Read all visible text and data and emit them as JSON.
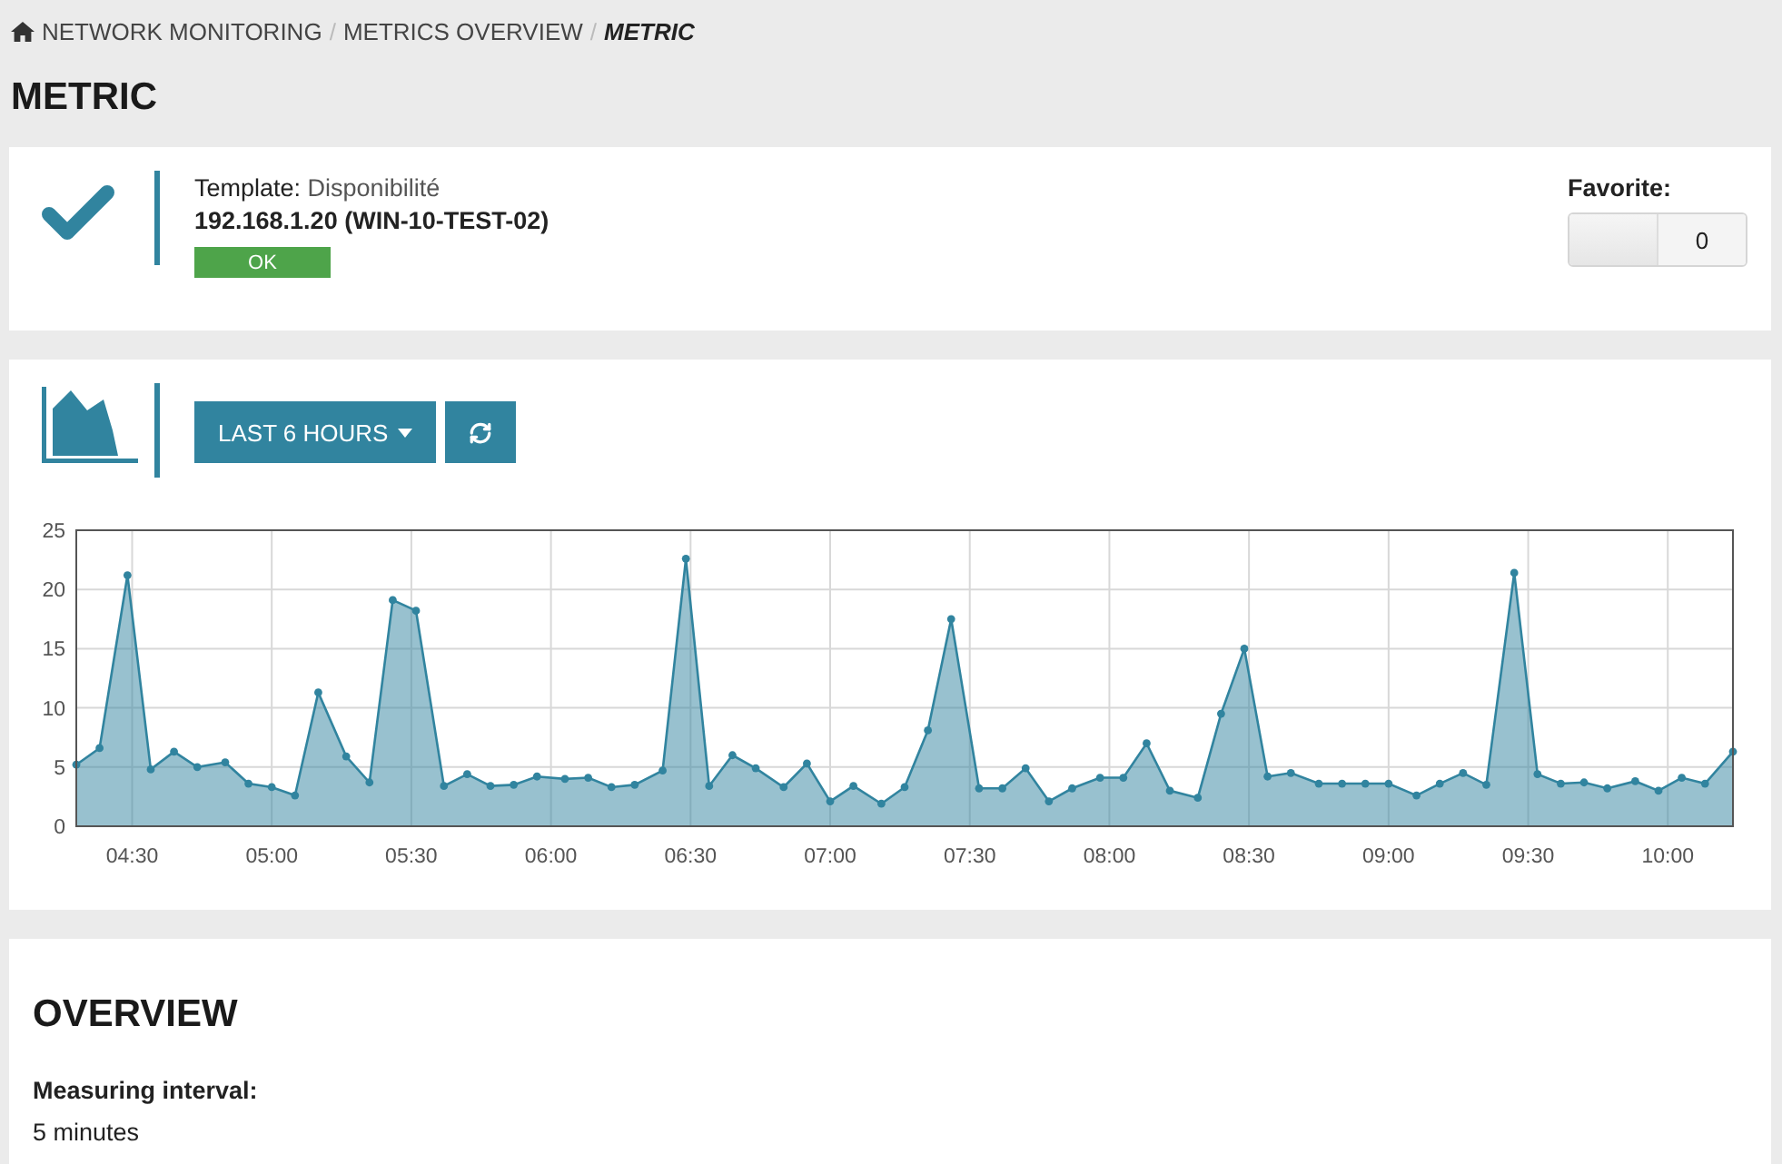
{
  "breadcrumb_separator": "/",
  "breadcrumb": [
    {
      "label": "NETWORK MONITORING",
      "current": false
    },
    {
      "label": "METRICS OVERVIEW",
      "current": false
    },
    {
      "label": "METRIC",
      "current": true
    }
  ],
  "title": "METRIC",
  "status_card": {
    "template_label": "Template:",
    "template_value": "Disponibilité",
    "host": "192.168.1.20 (WIN-10-TEST-02)",
    "status": {
      "label": "OK",
      "kind": "ok"
    },
    "favorite": {
      "label": "Favorite:",
      "count": "0"
    }
  },
  "chart_card": {
    "range_button": "LAST 6 HOURS",
    "chart_data": {
      "type": "area",
      "grid": true,
      "xlim": [
        258,
        614
      ],
      "ylim": [
        0,
        25
      ],
      "yticks": [
        0,
        5,
        10,
        15,
        20,
        25
      ],
      "xticks": [
        {
          "value": 270,
          "label": "04:30"
        },
        {
          "value": 300,
          "label": "05:00"
        },
        {
          "value": 330,
          "label": "05:30"
        },
        {
          "value": 360,
          "label": "06:00"
        },
        {
          "value": 390,
          "label": "06:30"
        },
        {
          "value": 420,
          "label": "07:00"
        },
        {
          "value": 450,
          "label": "07:30"
        },
        {
          "value": 480,
          "label": "08:00"
        },
        {
          "value": 510,
          "label": "08:30"
        },
        {
          "value": 540,
          "label": "09:00"
        },
        {
          "value": 570,
          "label": "09:30"
        },
        {
          "value": 600,
          "label": "10:00"
        }
      ],
      "x": [
        258,
        263,
        269,
        274,
        279,
        284,
        290,
        295,
        300,
        305,
        310,
        316,
        321,
        326,
        331,
        337,
        342,
        347,
        352,
        357,
        363,
        368,
        373,
        378,
        384,
        389,
        394,
        399,
        404,
        410,
        415,
        420,
        425,
        431,
        436,
        441,
        446,
        452,
        457,
        462,
        467,
        472,
        478,
        483,
        488,
        493,
        499,
        504,
        509,
        514,
        519,
        525,
        530,
        535,
        540,
        546,
        551,
        556,
        561,
        567,
        572,
        577,
        582,
        587,
        593,
        598,
        603,
        608,
        614
      ],
      "series": [
        {
          "color": "#31849f",
          "values": [
            5.2,
            6.6,
            21.2,
            4.8,
            6.3,
            5.0,
            5.4,
            3.6,
            3.3,
            2.6,
            11.3,
            5.9,
            3.7,
            19.1,
            18.2,
            3.4,
            4.4,
            3.4,
            3.5,
            4.2,
            4.0,
            4.1,
            3.3,
            3.5,
            4.7,
            22.6,
            3.4,
            6.0,
            4.9,
            3.3,
            5.3,
            2.1,
            3.4,
            1.9,
            3.3,
            8.1,
            17.5,
            3.2,
            3.2,
            4.9,
            2.1,
            3.2,
            4.1,
            4.1,
            7.0,
            3.0,
            2.4,
            9.5,
            15.0,
            4.2,
            4.5,
            3.6,
            3.6,
            3.6,
            3.6,
            2.6,
            3.6,
            4.5,
            3.5,
            21.4,
            4.4,
            3.6,
            3.7,
            3.2,
            3.8,
            3.0,
            4.1,
            3.6,
            6.3
          ]
        }
      ]
    }
  },
  "overview": {
    "title": "OVERVIEW",
    "fields": [
      {
        "label": "Measuring interval:",
        "value": "5 minutes"
      }
    ]
  }
}
